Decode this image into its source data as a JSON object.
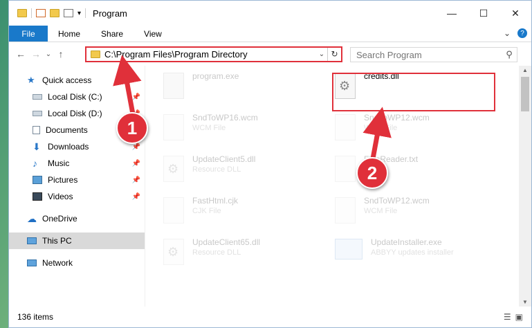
{
  "window": {
    "title": "Program",
    "controls": {
      "minimize": "—",
      "maximize": "☐",
      "close": "✕"
    }
  },
  "ribbon": {
    "tabs": [
      "File",
      "Home",
      "Share",
      "View"
    ],
    "expand_icon": "⌄",
    "help_icon": "?"
  },
  "address_bar": {
    "path": "C:\\Program Files\\Program Directory",
    "dropdown_icon": "⌄",
    "refresh_icon": "↻"
  },
  "search": {
    "placeholder": "Search Program",
    "icon": "⚲"
  },
  "nav": {
    "back": "←",
    "forward": "→",
    "recent": "⌄",
    "up": "↑",
    "items": [
      {
        "label": "Quick access",
        "icon": "star-icon",
        "pinned": false
      },
      {
        "label": "Local Disk (C:)",
        "icon": "drive-icon",
        "pinned": true
      },
      {
        "label": "Local Disk (D:)",
        "icon": "drive-icon",
        "pinned": true
      },
      {
        "label": "Documents",
        "icon": "documents-icon",
        "pinned": true
      },
      {
        "label": "Downloads",
        "icon": "downloads-icon",
        "pinned": true
      },
      {
        "label": "Music",
        "icon": "music-icon",
        "pinned": true
      },
      {
        "label": "Pictures",
        "icon": "pictures-icon",
        "pinned": true
      },
      {
        "label": "Videos",
        "icon": "videos-icon",
        "pinned": true
      },
      {
        "label": "OneDrive",
        "icon": "onedrive-icon",
        "pinned": false
      },
      {
        "label": "This PC",
        "icon": "pc-icon",
        "pinned": false,
        "selected": true
      },
      {
        "label": "Network",
        "icon": "network-icon",
        "pinned": false
      }
    ]
  },
  "files": [
    {
      "name": "program.exe",
      "type": "",
      "icon": "exe-icon",
      "faded": true
    },
    {
      "name": "credits.dll",
      "type": "",
      "icon": "dll-gear-icon",
      "faded": false,
      "highlighted": true
    },
    {
      "name": "SndToWP16.wcm",
      "type": "WCM File",
      "icon": "file-icon",
      "faded": true
    },
    {
      "name": "SndToWP12.wcm",
      "type": "WCM File",
      "icon": "file-icon",
      "faded": true
    },
    {
      "name": "UpdateClient5.dll",
      "type": "Resource DLL",
      "icon": "dll-gear-icon",
      "faded": true
    },
    {
      "name": "FineReader.txt",
      "type": "",
      "icon": "file-icon",
      "faded": true
    },
    {
      "name": "FastHtml.cjk",
      "type": "CJK File",
      "icon": "file-icon",
      "faded": true
    },
    {
      "name": "SndToWP12.wcm",
      "type": "WCM File",
      "icon": "file-icon",
      "faded": true
    },
    {
      "name": "UpdateClient65.dll",
      "type": "Resource DLL",
      "icon": "dll-gear-icon",
      "faded": true
    },
    {
      "name": "UpdateInstaller.exe",
      "type": "ABBYY updates installer",
      "icon": "installer-icon",
      "faded": true
    }
  ],
  "annotations": {
    "step1": "1",
    "step2": "2",
    "color": "#e0303a"
  },
  "status": {
    "item_count": "136 items"
  }
}
